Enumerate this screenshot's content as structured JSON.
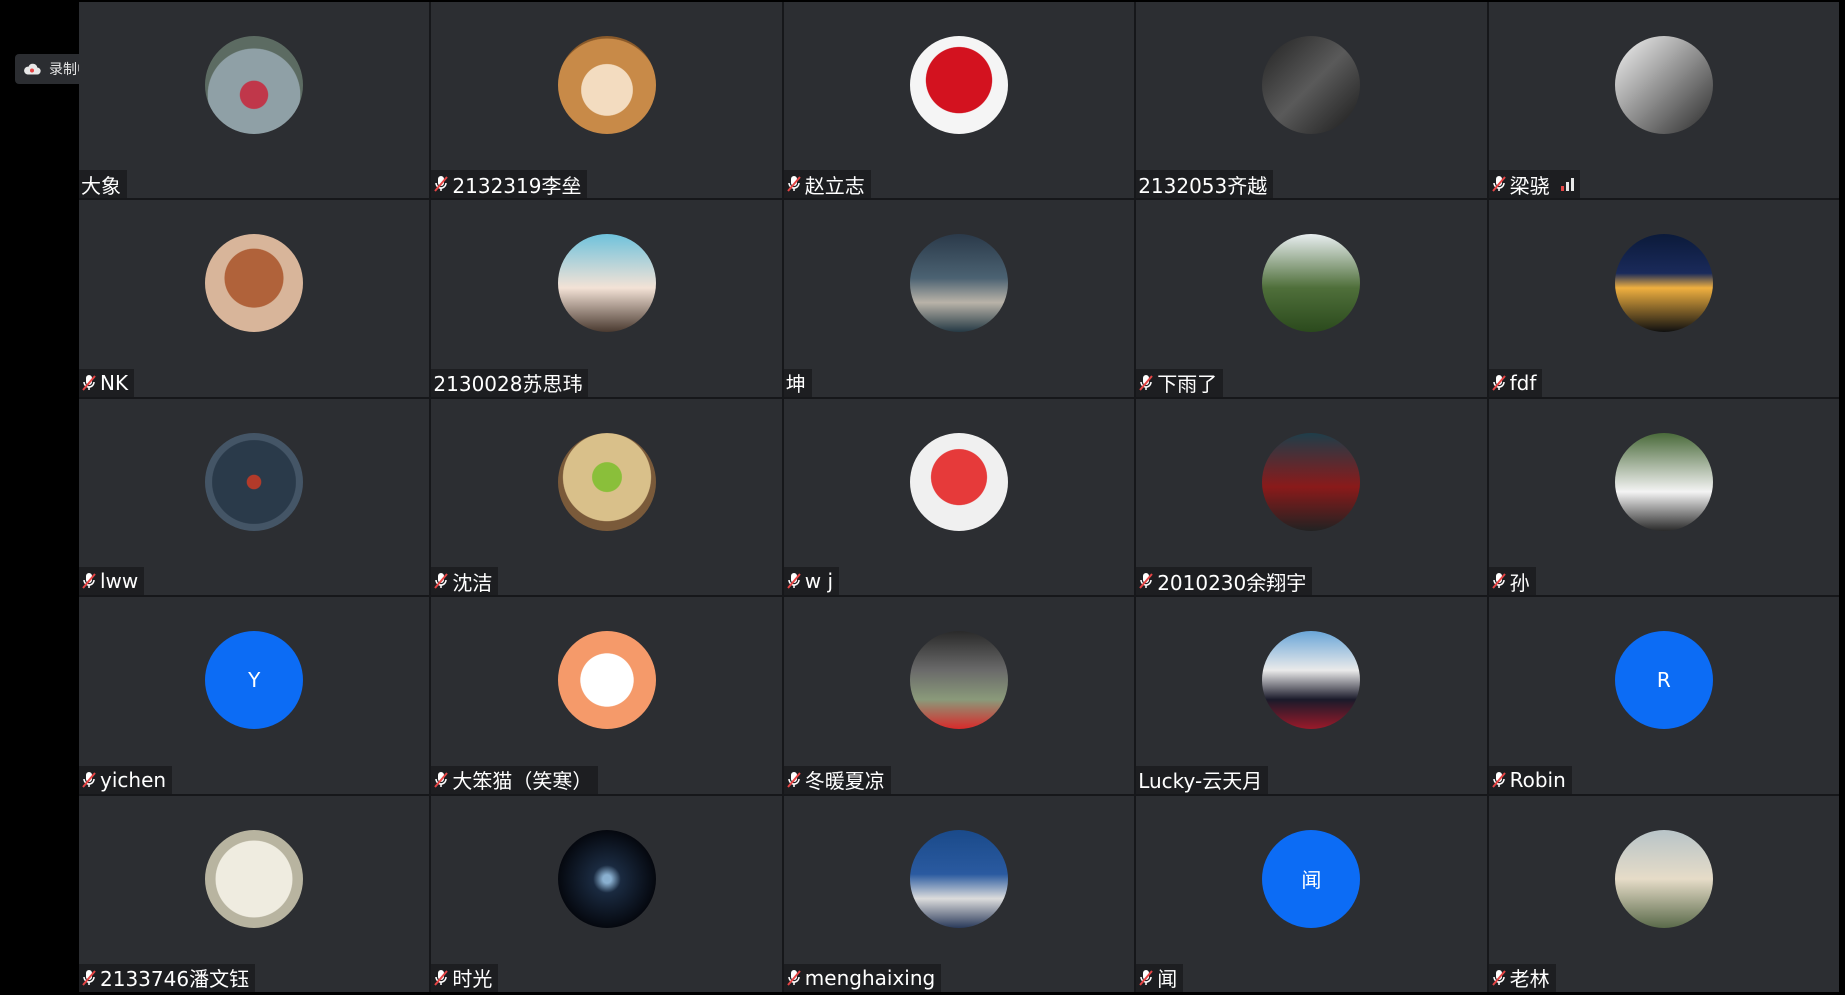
{
  "recording": {
    "label": "录制中",
    "icon": "cloud-icon"
  },
  "colors": {
    "tile_bg": "#2c2e32",
    "initial_avatar_bg": "#0c6cf5",
    "mic_muted": "#e64545"
  },
  "participants": [
    {
      "name": "大象",
      "muted": false,
      "avatar": "photo"
    },
    {
      "name": "2132319李垒",
      "muted": true,
      "avatar": "photo"
    },
    {
      "name": "赵立志",
      "muted": true,
      "avatar": "photo"
    },
    {
      "name": "2132053齐越",
      "muted": false,
      "avatar": "photo"
    },
    {
      "name": "梁骁",
      "muted": true,
      "avatar": "photo",
      "signal": true
    },
    {
      "name": "NK",
      "muted": true,
      "avatar": "photo"
    },
    {
      "name": "2130028苏思玮",
      "muted": false,
      "avatar": "photo"
    },
    {
      "name": "坤",
      "muted": false,
      "avatar": "photo"
    },
    {
      "name": "下雨了",
      "muted": true,
      "avatar": "photo"
    },
    {
      "name": "fdf",
      "muted": true,
      "avatar": "photo"
    },
    {
      "name": "lww",
      "muted": true,
      "avatar": "photo"
    },
    {
      "name": "沈洁",
      "muted": true,
      "avatar": "photo"
    },
    {
      "name": "w j",
      "muted": true,
      "avatar": "photo"
    },
    {
      "name": "2010230余翔宇",
      "muted": true,
      "avatar": "photo"
    },
    {
      "name": "孙",
      "muted": true,
      "avatar": "photo"
    },
    {
      "name": "yichen",
      "muted": true,
      "avatar": "initial",
      "initial": "Y"
    },
    {
      "name": "大笨猫（笑寒）",
      "muted": true,
      "avatar": "photo"
    },
    {
      "name": "冬暖夏凉",
      "muted": true,
      "avatar": "photo"
    },
    {
      "name": "Lucky-云天月",
      "muted": false,
      "avatar": "photo"
    },
    {
      "name": "Robin",
      "muted": true,
      "avatar": "initial",
      "initial": "R"
    },
    {
      "name": "2133746潘文钰",
      "muted": true,
      "avatar": "photo"
    },
    {
      "name": "时光",
      "muted": true,
      "avatar": "photo"
    },
    {
      "name": "menghaixing",
      "muted": true,
      "avatar": "photo"
    },
    {
      "name": "闻",
      "muted": true,
      "avatar": "initial",
      "initial": "闻"
    },
    {
      "name": "老林",
      "muted": true,
      "avatar": "photo"
    }
  ]
}
